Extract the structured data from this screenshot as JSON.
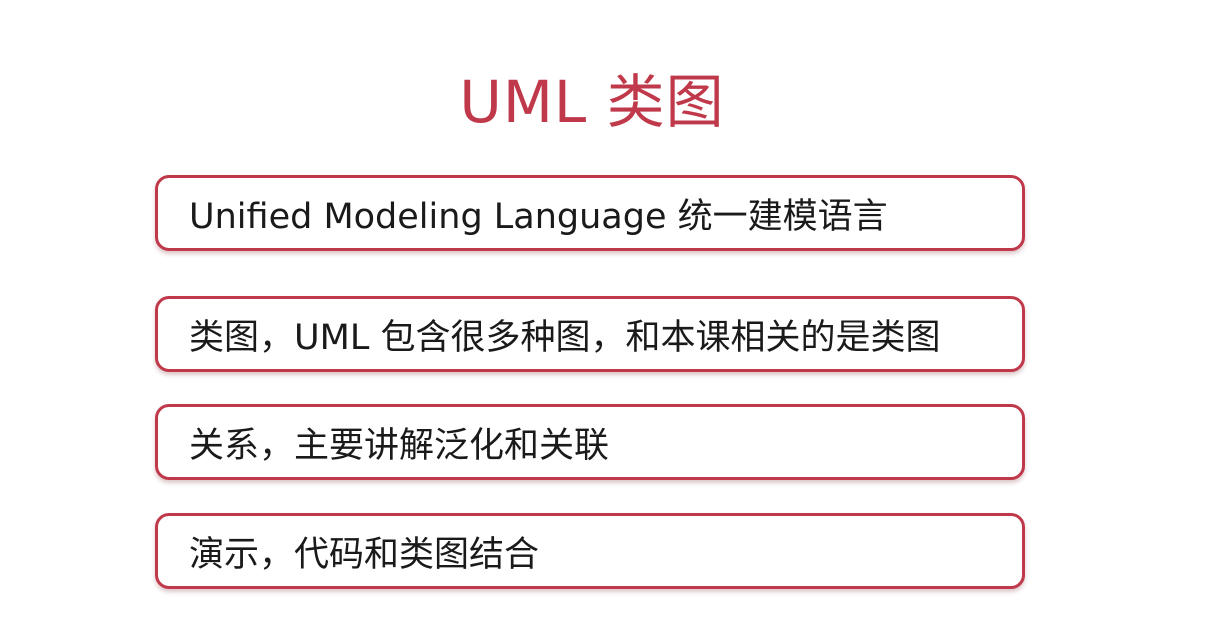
{
  "slide": {
    "title": "UML 类图",
    "items": [
      {
        "text": "Unified Modeling Language 统一建模语言"
      },
      {
        "text": "类图，UML 包含很多种图，和本课相关的是类图"
      },
      {
        "text": "关系，主要讲解泛化和关联"
      },
      {
        "text": "演示，代码和类图结合"
      }
    ]
  },
  "colors": {
    "accent": "#c0394b",
    "text": "#1a1a1a",
    "background": "#ffffff"
  }
}
